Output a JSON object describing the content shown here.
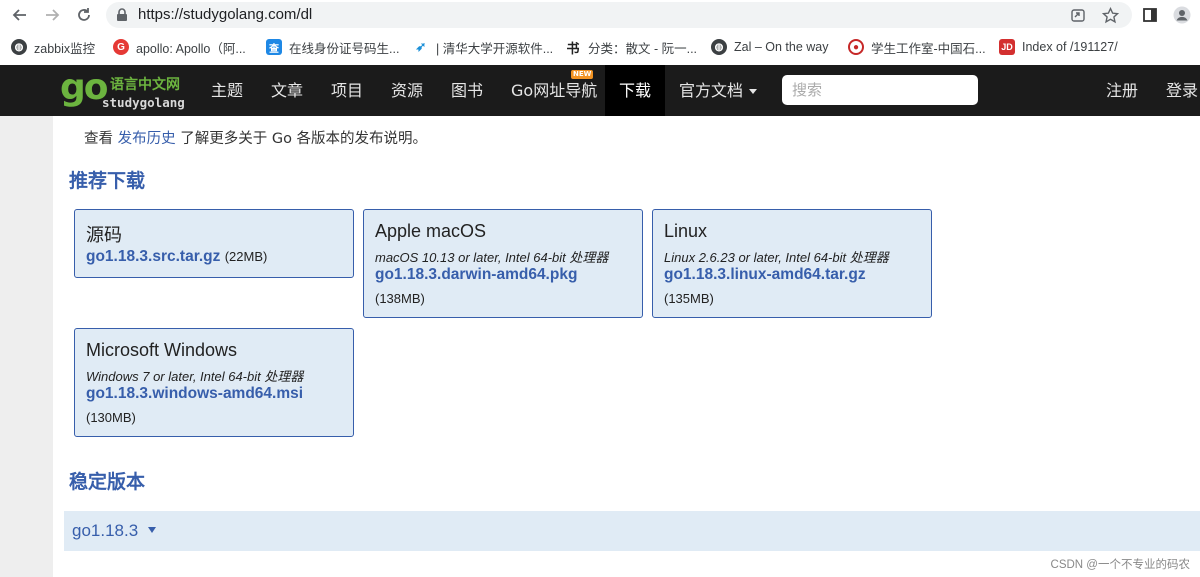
{
  "browser": {
    "url": "https://studygolang.com/dl",
    "bookmarks": [
      {
        "label": "zabbix监控",
        "icon": "globe-icon"
      },
      {
        "label": "apollo: Apollo（阿...",
        "icon": "apollo-icon"
      },
      {
        "label": "在线身份证号码生...",
        "icon": "id-lookup-icon"
      },
      {
        "label": "| 清华大学开源软件...",
        "icon": "tsinghua-icon"
      },
      {
        "label": "分类：散文 - 阮一...",
        "icon": "calligraphy-icon"
      },
      {
        "label": "Zal – On the way",
        "icon": "globe-icon"
      },
      {
        "label": "学生工作室-中国石...",
        "icon": "student-office-icon"
      },
      {
        "label": "Index of /191127/",
        "icon": "jd-icon"
      }
    ]
  },
  "site": {
    "logo_cn": "语言中文网",
    "logo_en": "studygolang",
    "nav": [
      {
        "label": "主题"
      },
      {
        "label": "文章"
      },
      {
        "label": "项目"
      },
      {
        "label": "资源"
      },
      {
        "label": "图书"
      },
      {
        "label": "Go网址导航"
      },
      {
        "label": "下载"
      },
      {
        "label": "官方文档"
      }
    ],
    "new_badge": "NEW",
    "search_placeholder": "搜索",
    "register": "注册",
    "login": "登录"
  },
  "content": {
    "intro_prefix": "查看 ",
    "intro_link": "发布历史",
    "intro_suffix": " 了解更多关于 Go 各版本的发布说明。",
    "featured_title": "推荐下载",
    "cards": [
      {
        "title": "源码",
        "subtitle": "",
        "file": "go1.18.3.src.tar.gz",
        "size": "(22MB)"
      },
      {
        "title": "Apple macOS",
        "subtitle": "macOS 10.13 or later, Intel 64-bit 处理器",
        "file": "go1.18.3.darwin-amd64.pkg",
        "size": "(138MB)"
      },
      {
        "title": "Linux",
        "subtitle": "Linux 2.6.23 or later, Intel 64-bit 处理器",
        "file": "go1.18.3.linux-amd64.tar.gz",
        "size": "(135MB)"
      },
      {
        "title": "Microsoft Windows",
        "subtitle": "Windows 7 or later, Intel 64-bit 处理器",
        "file": "go1.18.3.windows-amd64.msi",
        "size": "(130MB)"
      }
    ],
    "stable_title": "稳定版本",
    "stable_version": "go1.18.3"
  },
  "watermark": "CSDN @一个不专业的码农",
  "colors": {
    "link": "#375eab",
    "card_bg": "#e0ebf5",
    "logo_green": "#6cb43f",
    "navbar": "#1b1b1b"
  }
}
